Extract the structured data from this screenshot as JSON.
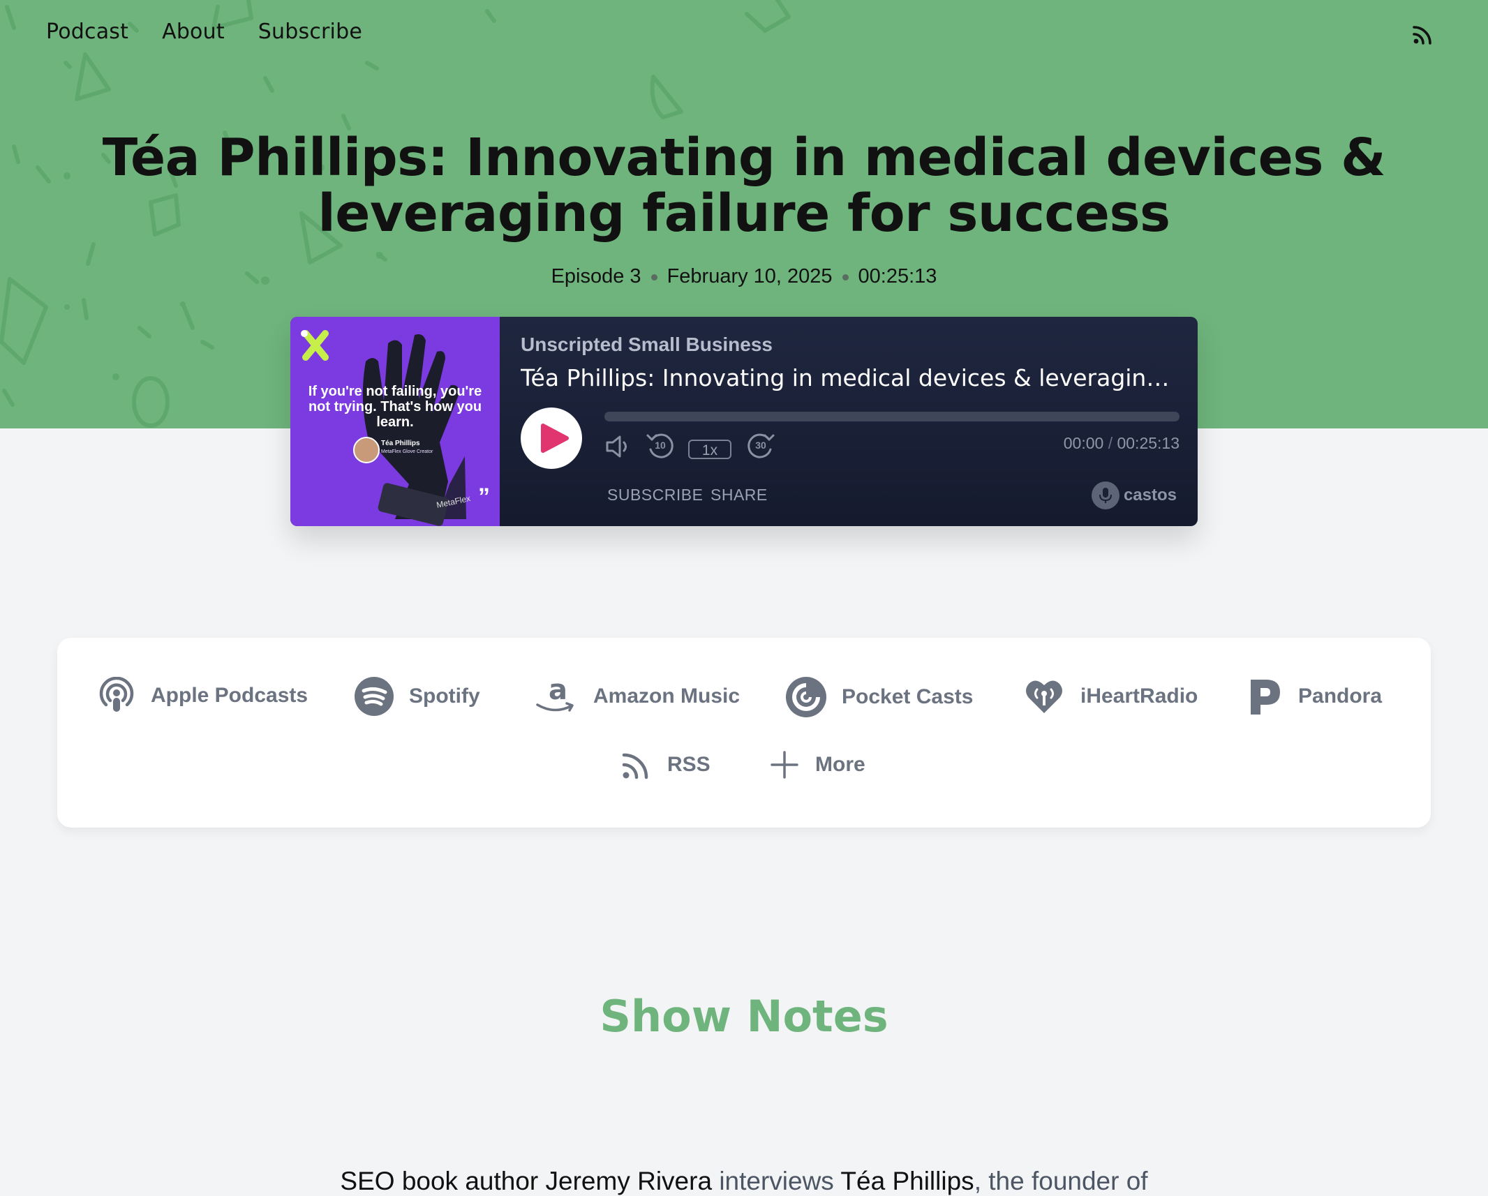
{
  "nav": {
    "items": [
      "Podcast",
      "About",
      "Subscribe"
    ],
    "rss_icon": "rss-icon"
  },
  "episode": {
    "title": "Téa Phillips: Innovating in medical devices & leveraging failure for success",
    "number": "Episode 3",
    "date": "February 10, 2025",
    "duration": "00:25:13"
  },
  "player": {
    "show_name": "Unscripted Small Business",
    "episode_title": "Téa Phillips: Innovating in medical devices & leveraging failure for success",
    "speed": "1x",
    "skip_back": "10",
    "skip_forward": "30",
    "current_time": "00:00",
    "time_separator": "/",
    "total_time": "00:25:13",
    "progress": 0,
    "subscribe_label": "SUBSCRIBE",
    "share_label": "SHARE",
    "brand": "castos",
    "artwork": {
      "quote": "If you're not failing, you're not trying. That's how you learn.",
      "name": "Téa Phillips",
      "role": "MetaFlex Glove Creator",
      "brand": "MetaFlex",
      "background": "#7b3be0"
    }
  },
  "platforms": [
    {
      "label": "Apple Podcasts",
      "icon": "apple-podcasts-icon"
    },
    {
      "label": "Spotify",
      "icon": "spotify-icon"
    },
    {
      "label": "Amazon Music",
      "icon": "amazon-music-icon"
    },
    {
      "label": "Pocket Casts",
      "icon": "pocket-casts-icon"
    },
    {
      "label": "iHeartRadio",
      "icon": "iheartradio-icon"
    },
    {
      "label": "Pandora",
      "icon": "pandora-icon"
    },
    {
      "label": "RSS",
      "icon": "rss-icon"
    },
    {
      "label": "More",
      "icon": "plus-icon"
    }
  ],
  "show_notes": {
    "heading": "Show Notes",
    "intro": {
      "part1": "SEO book author Jeremy Rivera ",
      "link1": "interviews",
      "part2": " Téa Phillips",
      "link2": ", the founder of"
    }
  },
  "colors": {
    "hero_green": "#6fb47c",
    "player_bg": "#1a2035",
    "play_accent": "#e0356f",
    "artwork_purple": "#7b3be0",
    "page_bg": "#f3f4f6"
  }
}
